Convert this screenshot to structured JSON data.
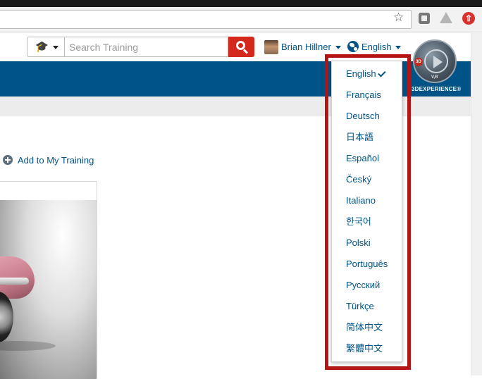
{
  "browser": {
    "star_icon": "star-icon",
    "extensions": [
      "extension-icon",
      "drive-icon",
      "upload-icon"
    ]
  },
  "header": {
    "search": {
      "placeholder": "Search Training",
      "value": ""
    },
    "user": {
      "name": "Brian Hillner"
    },
    "language": {
      "current": "English"
    },
    "compass": {
      "badge": "3D",
      "vr": "V,R",
      "brand": "3DEXPERIENCE®"
    }
  },
  "content": {
    "add_to_training": "Add to My Training"
  },
  "language_menu": {
    "items": [
      {
        "label": "English",
        "selected": true
      },
      {
        "label": "Français",
        "selected": false
      },
      {
        "label": "Deutsch",
        "selected": false
      },
      {
        "label": "日本語",
        "selected": false
      },
      {
        "label": "Español",
        "selected": false
      },
      {
        "label": "Český",
        "selected": false
      },
      {
        "label": "Italiano",
        "selected": false
      },
      {
        "label": "한국어",
        "selected": false
      },
      {
        "label": "Polski",
        "selected": false
      },
      {
        "label": "Português",
        "selected": false
      },
      {
        "label": "Русский",
        "selected": false
      },
      {
        "label": "Türkçe",
        "selected": false
      },
      {
        "label": "简体中文",
        "selected": false
      },
      {
        "label": "繁體中文",
        "selected": false
      }
    ]
  },
  "colors": {
    "brand_blue": "#005386",
    "search_red": "#d4281c",
    "highlight_red": "#b31414"
  }
}
